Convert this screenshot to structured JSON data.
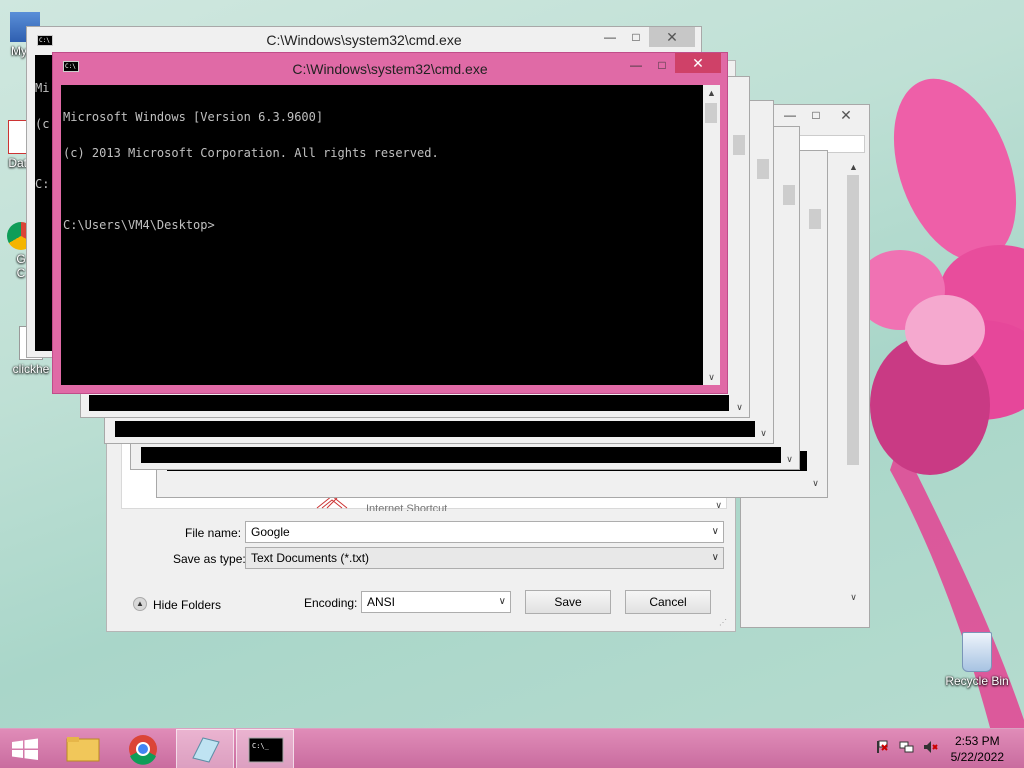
{
  "desktop": {
    "icons": [
      {
        "label": "My C"
      },
      {
        "label": "Data"
      },
      {
        "label": "G\nC"
      },
      {
        "label": "clickhe"
      },
      {
        "label": "Recycle Bin"
      }
    ]
  },
  "cmd_front": {
    "title": "C:\\Windows\\system32\\cmd.exe",
    "lines": [
      "Microsoft Windows [Version 6.3.9600]",
      "(c) 2013 Microsoft Corporation. All rights reserved.",
      "",
      "C:\\Users\\VM4\\Desktop>"
    ]
  },
  "cmd_back": {
    "title": "C:\\Windows\\system32\\cmd.exe",
    "lines": [
      "Mi",
      "(c",
      "",
      "C:"
    ]
  },
  "save_dialog": {
    "partial_item": "Internet Shortcut",
    "file_name_label": "File name:",
    "file_name_value": "Google",
    "save_type_label": "Save as type:",
    "save_type_value": "Text Documents (*.txt)",
    "hide_folders": "Hide Folders",
    "encoding_label": "Encoding:",
    "encoding_value": "ANSI",
    "save_button": "Save",
    "cancel_button": "Cancel"
  },
  "taskbar": {
    "time": "2:53 PM",
    "date": "5/22/2022"
  },
  "colors": {
    "taskbar": "#d77aae",
    "active_window_frame": "#e06aa6",
    "close_button": "#cf4168"
  }
}
